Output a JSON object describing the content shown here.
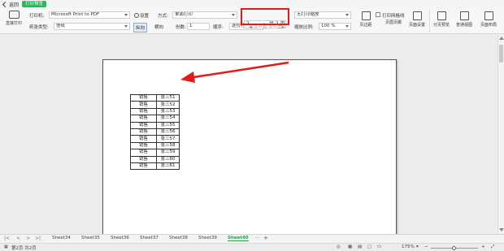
{
  "titlebar": {
    "back_label": "返回",
    "mode_label": "打印预览"
  },
  "ribbon": {
    "direct_print": "直接打印",
    "printer_label": "打印机:",
    "printer_value": "Microsoft Print to PDF",
    "settings_label": "设置",
    "method_label": "方式:",
    "method_value": "单面打印",
    "paper_type_label": "纸张类型:",
    "paper_type_value": "信纸",
    "portrait_label": "纵向",
    "landscape_label": "横向",
    "copies_label": "份数:",
    "copies_value": "1",
    "order_label": "顺序:",
    "order_value": "逐份打印",
    "page_current": "2",
    "page_total": "共 2 页",
    "prev_page": "上一页",
    "next_page": "下一页",
    "scale_value": "无打印缩放",
    "gridlines_label": "打印网格线",
    "zoom_label": "缩放比例:",
    "zoom_value": "100 %",
    "btn_margins": "页边距",
    "btn_header": "页眉页脚",
    "btn_page_setup": "页面设置",
    "btn_page_break": "分页预览",
    "btn_normal": "普通视图",
    "btn_page_layout": "页面布局"
  },
  "sheet_rows": [
    [
      "销售",
      "张三51"
    ],
    [
      "销售",
      "张三52"
    ],
    [
      "销售",
      "张三53"
    ],
    [
      "销售",
      "张三54"
    ],
    [
      "销售",
      "张三55"
    ],
    [
      "销售",
      "张三56"
    ],
    [
      "销售",
      "张三57"
    ],
    [
      "销售",
      "张三58"
    ],
    [
      "销售",
      "张三59"
    ],
    [
      "销售",
      "张三60"
    ],
    [
      "销售",
      "张三61"
    ]
  ],
  "sheet_tabs": [
    "Sheet34",
    "Sheet35",
    "Sheet36",
    "Sheet37",
    "Sheet38",
    "Sheet39",
    "Sheet40"
  ],
  "active_tab": "Sheet40",
  "tabs_more": "···",
  "tabs_add": "+",
  "status": {
    "page_info": "第2页 共2页",
    "zoom_pct": "175%"
  },
  "colors": {
    "accent": "#2fb35c",
    "highlight": "#e21b1b"
  }
}
